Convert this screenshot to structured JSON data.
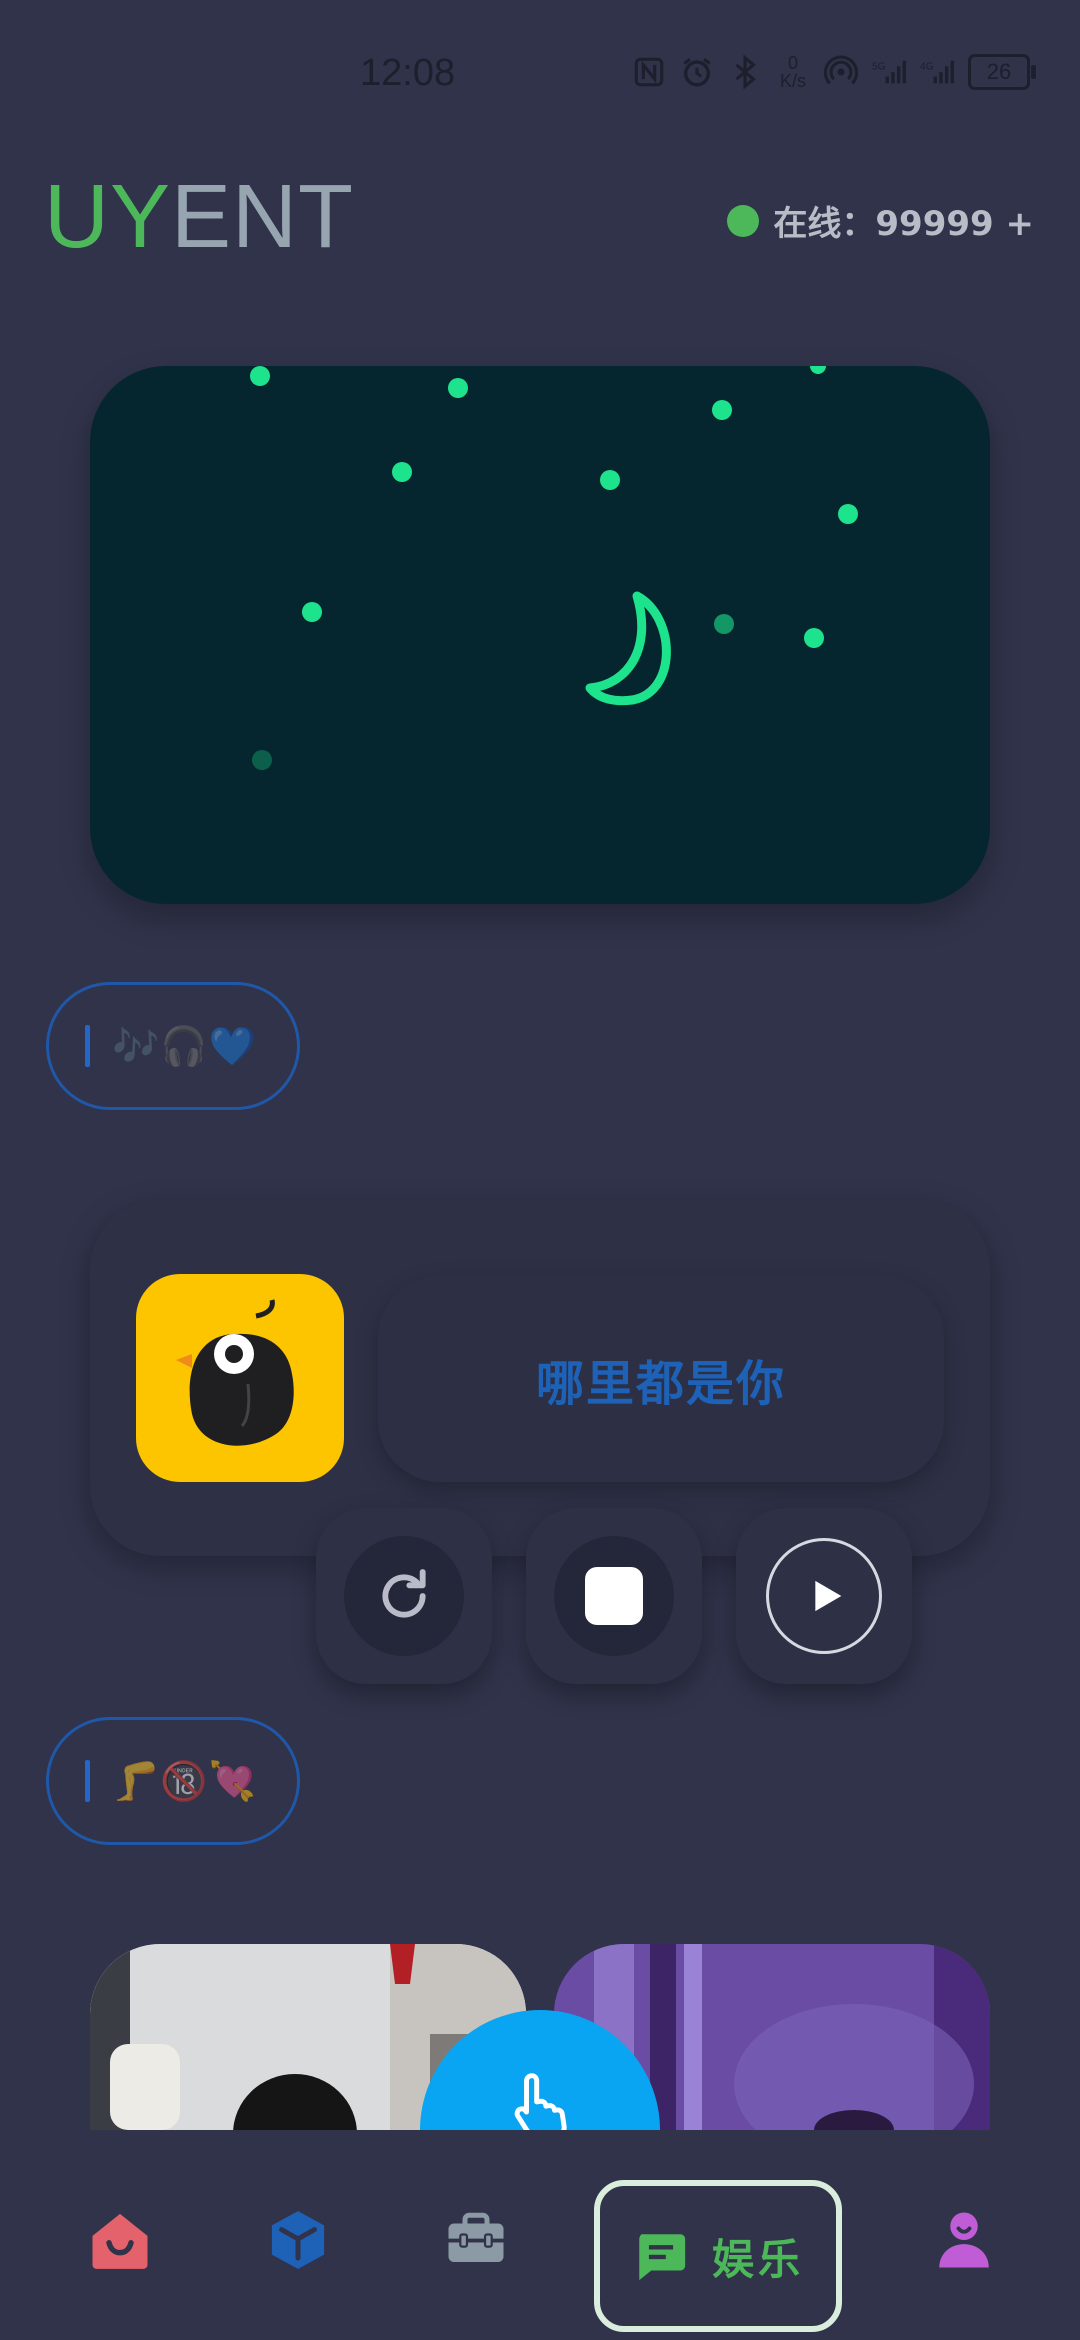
{
  "status_bar": {
    "time": "12:08",
    "net_speed_value": "0",
    "net_speed_unit": "K/s",
    "signal_5g": "5G",
    "signal_4g": "4G",
    "battery": "26",
    "icons": [
      "nfc-icon",
      "alarm-icon",
      "bluetooth-icon",
      "hotspot-icon",
      "signal-icon"
    ]
  },
  "header": {
    "logo_part1": "UY",
    "logo_part2": "ENT",
    "online_label": "在线：99999 +"
  },
  "tags": {
    "music_tag": "🎶🎧💙",
    "adult_tag": "🦵🔞💘"
  },
  "player": {
    "song_title": "哪里都是你",
    "app_icon": "bird-logo-icon",
    "controls": [
      "refresh-icon",
      "stop-icon",
      "play-icon"
    ]
  },
  "fab": {
    "icon": "tap-hand-icon"
  },
  "bottom_nav": {
    "items": [
      "home-icon",
      "cube-icon",
      "toolbox-icon",
      "chat-icon",
      "profile-icon"
    ],
    "active_label": "娱乐"
  },
  "colors": {
    "background": "#30334a",
    "accent_green": "#4cb85a",
    "night_card": "#05262f",
    "star": "#1ee38d",
    "song_title": "#1e62b8",
    "fab": "#0aa5f2",
    "app_icon_bg": "#fdc500"
  }
}
